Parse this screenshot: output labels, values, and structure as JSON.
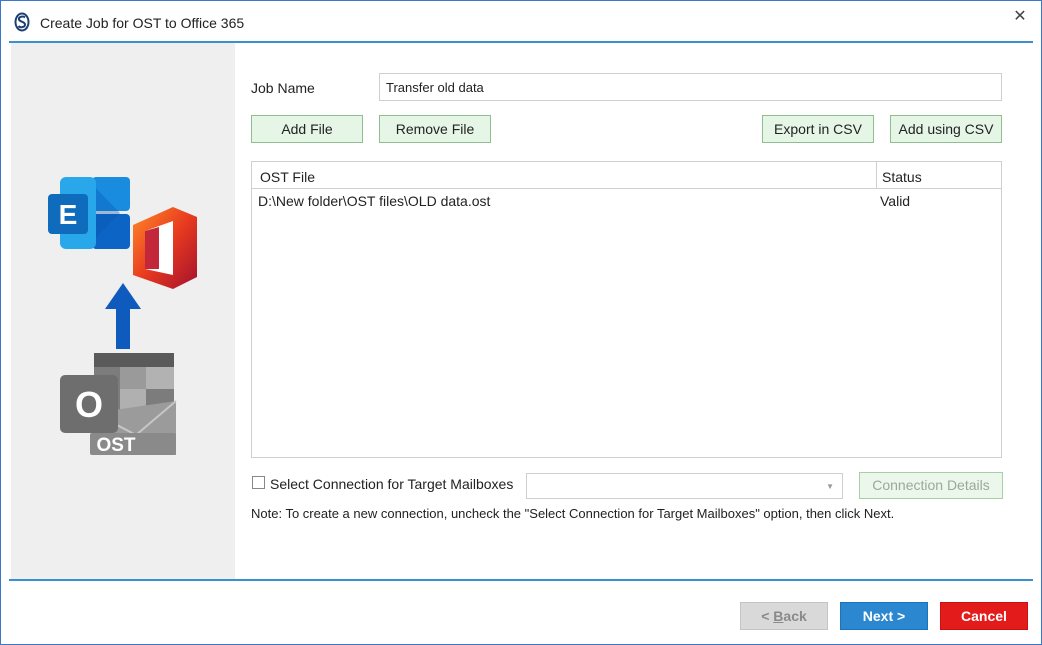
{
  "window": {
    "title": "Create Job for OST to Office 365",
    "close_glyph": "✕",
    "icon": "app-logo-icon"
  },
  "left_panel": {
    "icons": [
      "exchange-icon",
      "office-icon",
      "arrow-up-icon",
      "outlook-ost-icon"
    ],
    "exchange_letter": "E",
    "outlook_letter": "O",
    "ost_label": "OST"
  },
  "form": {
    "job_name_label": "Job Name",
    "job_name_value": "Transfer old data"
  },
  "toolbar": {
    "add_file": "Add File",
    "remove_file": "Remove File",
    "export_csv": "Export in CSV",
    "add_csv": "Add using CSV"
  },
  "file_table": {
    "columns": [
      "OST File",
      "Status"
    ],
    "rows": [
      {
        "file": "D:\\New folder\\OST files\\OLD data.ost",
        "status": "Valid"
      }
    ]
  },
  "connection": {
    "checkbox_label": "Select Connection for Target Mailboxes",
    "checked": false,
    "dropdown_value": "",
    "details_button": "Connection Details"
  },
  "note": "Note: To create a new connection, uncheck the \"Select Connection for Target Mailboxes\" option, then click Next.",
  "footer": {
    "back_prefix": "< ",
    "back_accel": "B",
    "back_rest": "ack",
    "next": "Next >",
    "cancel": "Cancel"
  },
  "colors": {
    "accent_line": "#3a8fd0",
    "next_button": "#2b87cf",
    "cancel_button": "#e41b1b",
    "green_button": "#e6f6e6"
  }
}
